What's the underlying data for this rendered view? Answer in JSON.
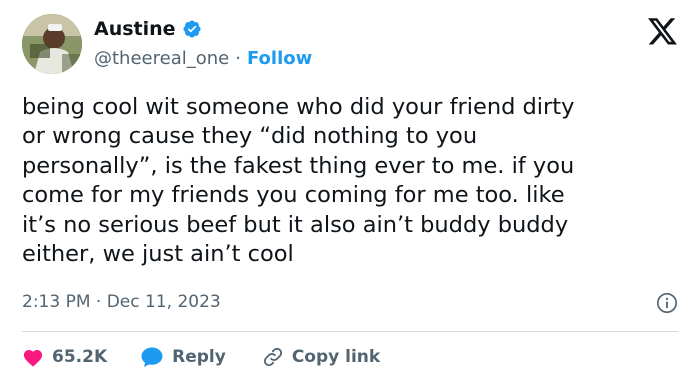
{
  "user": {
    "display_name": "Austine",
    "handle": "@theereal_one",
    "separator": "·",
    "follow_label": "Follow"
  },
  "tweet": {
    "text": "being cool wit someone who did your friend dirty\nor wrong cause they “did nothing to you\npersonally”, is the fakest thing ever to me. if you\ncome for my friends you coming for me too. like\nit’s no serious beef but it also ain’t buddy buddy\neither, we just ain’t cool",
    "timestamp": "2:13 PM · Dec 11, 2023"
  },
  "actions": {
    "like_count": "65.2K",
    "reply_label": "Reply",
    "copy_label": "Copy link"
  },
  "icons": {
    "verified": "verified-badge-icon",
    "x_logo": "x-logo-icon",
    "info": "info-icon",
    "like": "heart-icon",
    "reply": "reply-bubble-icon",
    "copy": "link-icon"
  },
  "colors": {
    "accent": "#1d9bf0",
    "heart": "#f91880",
    "text": "#0f1419",
    "muted": "#536471",
    "divider": "#cfd9de"
  }
}
